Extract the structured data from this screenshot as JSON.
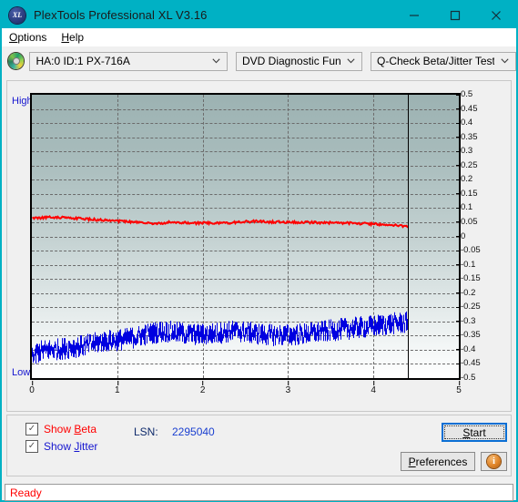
{
  "window": {
    "title": "PlexTools Professional XL V3.16",
    "app_icon": "xl-disc-icon",
    "minimize": "—",
    "maximize": "□",
    "close": "✕"
  },
  "menubar": {
    "items": [
      {
        "label": "Options",
        "accel": "O"
      },
      {
        "label": "Help",
        "accel": "H"
      }
    ]
  },
  "toolbar": {
    "drive_icon": "optical-disc-icon",
    "drive": "HA:0 ID:1  PX-716A",
    "function": "DVD Diagnostic Functions",
    "test": "Q-Check Beta/Jitter Test",
    "arrow": "⌄"
  },
  "chart_axis": {
    "high_label": "High",
    "low_label": "Low"
  },
  "controls": {
    "show_beta": {
      "label_pre": "Show ",
      "accel": "B",
      "label_post": "eta",
      "checked": true,
      "check": "✓",
      "color": "#ff0000"
    },
    "show_jitter": {
      "label_pre": "Show ",
      "accel": "J",
      "label_post": "itter",
      "checked": true,
      "check": "✓",
      "color": "#1515cf"
    },
    "lsn_label": "LSN:",
    "lsn_value": "2295040",
    "start_pre": "",
    "start_accel": "S",
    "start_post": "tart",
    "prefs_pre": "",
    "prefs_accel": "P",
    "prefs_post": "references",
    "info_glyph": "i"
  },
  "statusbar": {
    "text": "Ready"
  },
  "chart_data": {
    "type": "line",
    "title": "Q-Check Beta/Jitter Test",
    "xlabel": "",
    "ylabel": "",
    "xlim": [
      0,
      5
    ],
    "ylim": [
      -0.5,
      0.5
    ],
    "grid": true,
    "legend_position": "below-left",
    "x_ticks": [
      0,
      1,
      2,
      3,
      4,
      5
    ],
    "y_ticks": [
      0.5,
      0.45,
      0.4,
      0.35,
      0.3,
      0.25,
      0.2,
      0.15,
      0.1,
      0.05,
      0,
      -0.05,
      -0.1,
      -0.15,
      -0.2,
      -0.25,
      -0.3,
      -0.35,
      -0.4,
      -0.45,
      -0.5
    ],
    "y_tick_labels": [
      "0.5",
      "0.45",
      "0.4",
      "0.35",
      "0.3",
      "0.25",
      "0.2",
      "0.15",
      "0.1",
      "0.05",
      "0",
      "-0.05",
      "-0.1",
      "-0.15",
      "-0.2",
      "-0.25",
      "-0.3",
      "-0.35",
      "-0.4",
      "-0.45",
      "-0.5"
    ],
    "data_end_x": 4.4,
    "annotations": [
      {
        "type": "vline",
        "x": 4.4,
        "color": "#000000",
        "label": "end-of-data marker"
      }
    ],
    "series": [
      {
        "name": "Beta",
        "color": "#ff0000",
        "style": "line",
        "noise": 0.004,
        "x": [
          0.0,
          0.1,
          0.2,
          0.3,
          0.4,
          0.5,
          0.6,
          0.7,
          0.8,
          0.9,
          1.0,
          1.1,
          1.2,
          1.3,
          1.4,
          1.5,
          1.6,
          1.7,
          1.8,
          1.9,
          2.0,
          2.1,
          2.2,
          2.3,
          2.4,
          2.5,
          2.6,
          2.7,
          2.8,
          2.9,
          3.0,
          3.1,
          3.2,
          3.3,
          3.4,
          3.5,
          3.6,
          3.7,
          3.8,
          3.9,
          4.0,
          4.1,
          4.2,
          4.3,
          4.4
        ],
        "values": [
          0.065,
          0.066,
          0.067,
          0.068,
          0.066,
          0.064,
          0.062,
          0.06,
          0.058,
          0.056,
          0.054,
          0.052,
          0.05,
          0.048,
          0.046,
          0.045,
          0.05,
          0.049,
          0.048,
          0.047,
          0.048,
          0.047,
          0.046,
          0.048,
          0.05,
          0.052,
          0.053,
          0.052,
          0.051,
          0.051,
          0.051,
          0.05,
          0.05,
          0.049,
          0.049,
          0.048,
          0.048,
          0.047,
          0.046,
          0.045,
          0.044,
          0.042,
          0.04,
          0.038,
          0.036
        ]
      },
      {
        "name": "Jitter",
        "color": "#0000e0",
        "style": "band",
        "noise": 0.022,
        "x": [
          0.0,
          0.1,
          0.2,
          0.3,
          0.4,
          0.5,
          0.6,
          0.7,
          0.8,
          0.9,
          1.0,
          1.1,
          1.2,
          1.3,
          1.4,
          1.5,
          1.6,
          1.7,
          1.8,
          1.9,
          2.0,
          2.1,
          2.2,
          2.3,
          2.4,
          2.5,
          2.6,
          2.7,
          2.8,
          2.9,
          3.0,
          3.1,
          3.2,
          3.3,
          3.4,
          3.5,
          3.6,
          3.7,
          3.8,
          3.9,
          4.0,
          4.1,
          4.2,
          4.3,
          4.4
        ],
        "values": [
          -0.415,
          -0.405,
          -0.4,
          -0.398,
          -0.394,
          -0.39,
          -0.386,
          -0.38,
          -0.372,
          -0.368,
          -0.366,
          -0.362,
          -0.356,
          -0.348,
          -0.342,
          -0.336,
          -0.336,
          -0.34,
          -0.344,
          -0.346,
          -0.346,
          -0.344,
          -0.34,
          -0.336,
          -0.334,
          -0.338,
          -0.342,
          -0.346,
          -0.348,
          -0.348,
          -0.348,
          -0.346,
          -0.344,
          -0.34,
          -0.336,
          -0.332,
          -0.328,
          -0.326,
          -0.322,
          -0.32,
          -0.316,
          -0.312,
          -0.308,
          -0.306,
          -0.304
        ]
      }
    ]
  }
}
